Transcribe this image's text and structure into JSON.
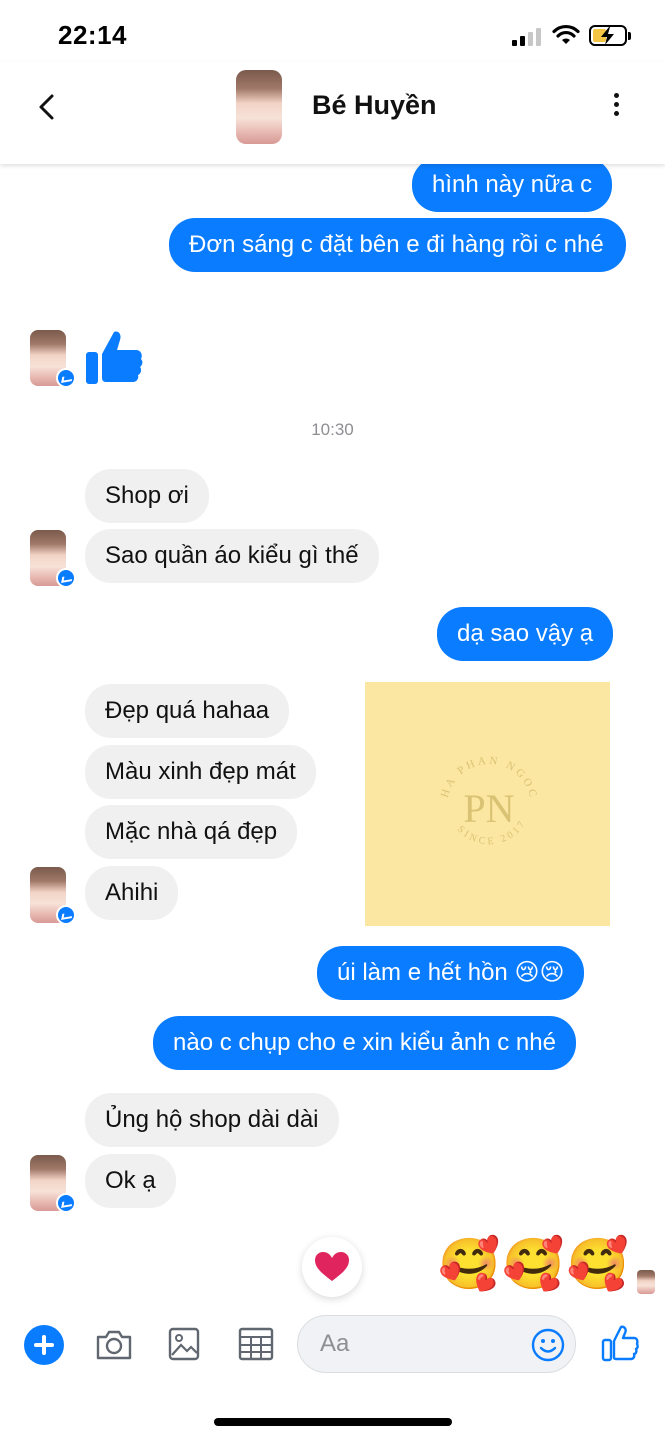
{
  "status_bar": {
    "time": "22:14"
  },
  "header": {
    "contact_name": "Bé Huyền"
  },
  "messages": {
    "out_1": "hình này nữa c",
    "out_2": "Đơn sáng c đặt bên e đi hàng rồi c nhé",
    "timestamp": "10:30",
    "in_1": "Shop ơi",
    "in_2": "Sao quần áo kiểu gì thế",
    "out_3": "dạ sao vậy ạ",
    "in_3": "Đẹp quá hahaa",
    "in_4": "Màu xinh đẹp mát",
    "in_5": "Mặc nhà qá đẹp",
    "in_6": "Ahihi",
    "out_4": "úi làm e hết hồn 😢😢",
    "out_5": "nào c chụp cho e xin kiểu ảnh c nhé",
    "in_7": "Ủng hộ shop dài dài",
    "in_8": "Ok ạ",
    "emoji_reply": "🥰🥰🥰"
  },
  "watermark": {
    "monogram": "PN",
    "ring_text": "HA PHAN NGOC STORE",
    "since": "SINCE 2017"
  },
  "composer": {
    "placeholder": "Aa"
  },
  "colors": {
    "accent": "#0a7cff",
    "incoming_bubble": "#f0f0f0",
    "sticker_bg": "#fbe7a1"
  },
  "icons": [
    "back-arrow-icon",
    "more-vertical-icon",
    "thumbs-up-icon",
    "heart-icon",
    "plus-icon",
    "camera-icon",
    "image-icon",
    "grid-icon",
    "smiley-icon",
    "like-icon"
  ]
}
